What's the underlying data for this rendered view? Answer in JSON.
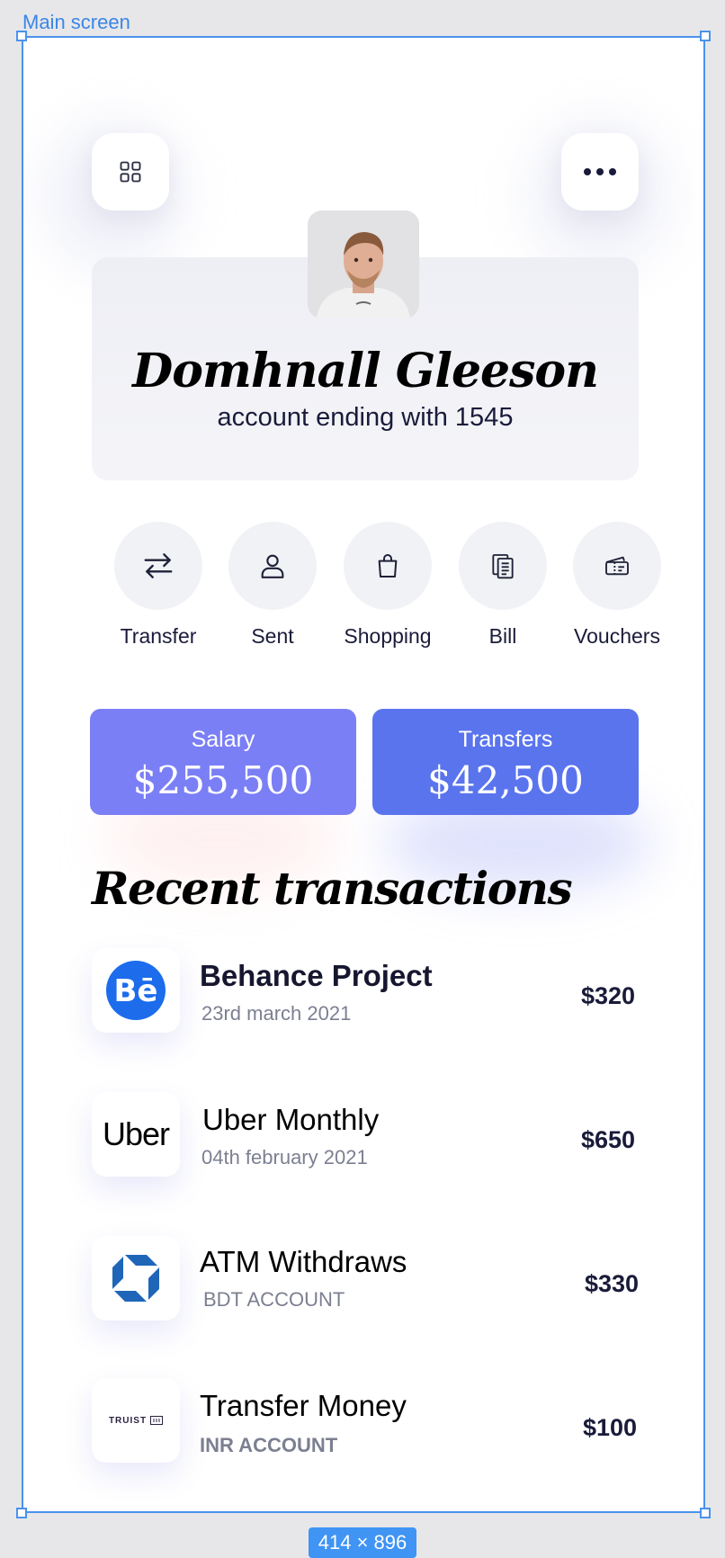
{
  "canvas": {
    "frame_label": "Main screen",
    "size_badge": "414 × 896"
  },
  "header": {
    "menu_icon": "grid-icon",
    "more_icon": "more-horizontal-icon"
  },
  "profile": {
    "name": "Domhnall Gleeson",
    "account_line": "account ending with 1545"
  },
  "actions": [
    {
      "label": "Transfer",
      "icon": "transfer-arrows-icon"
    },
    {
      "label": "Sent",
      "icon": "user-icon"
    },
    {
      "label": "Shopping",
      "icon": "shopping-bag-icon"
    },
    {
      "label": "Bill",
      "icon": "bill-document-icon"
    },
    {
      "label": "Vouchers",
      "icon": "voucher-ticket-icon"
    }
  ],
  "stats": [
    {
      "title": "Salary",
      "value": "$255,500",
      "color": "#7b7ff5"
    },
    {
      "title": "Transfers",
      "value": "$42,500",
      "color": "#5a74ee"
    }
  ],
  "recent": {
    "title": "Recent transactions",
    "items": [
      {
        "title": "Behance Project",
        "subtitle": "23rd march 2021",
        "amount": "$320",
        "logo": "behance-logo"
      },
      {
        "title": "Uber Monthly",
        "subtitle": "04th february 2021",
        "amount": "$650",
        "logo": "uber-logo",
        "logo_text": "Uber"
      },
      {
        "title": "ATM Withdraws",
        "subtitle": "BDT ACCOUNT",
        "amount": "$330",
        "logo": "chase-logo"
      },
      {
        "title": "Transfer Money",
        "subtitle": "INR ACCOUNT",
        "amount": "$100",
        "logo": "truist-logo",
        "logo_text": "TRUIST"
      }
    ]
  }
}
